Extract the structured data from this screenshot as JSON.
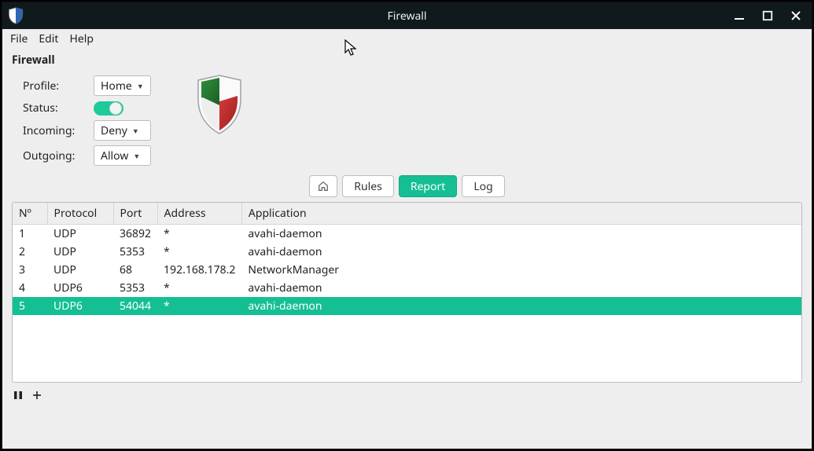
{
  "window": {
    "title": "Firewall"
  },
  "menubar": {
    "file": "File",
    "edit": "Edit",
    "help": "Help"
  },
  "panel": {
    "heading": "Firewall"
  },
  "form": {
    "profile_label": "Profile:",
    "status_label": "Status:",
    "incoming_label": "Incoming:",
    "outgoing_label": "Outgoing:",
    "profile_value": "Home",
    "incoming_value": "Deny",
    "outgoing_value": "Allow",
    "status_on": true
  },
  "colors": {
    "accent": "#15bf93",
    "titlebar_bg": "#10191b"
  },
  "tabs": {
    "home_tooltip": "Home",
    "rules": "Rules",
    "report": "Report",
    "log": "Log",
    "active": "report"
  },
  "table": {
    "columns": [
      "Nº",
      "Protocol",
      "Port",
      "Address",
      "Application"
    ],
    "rows": [
      {
        "n": "1",
        "protocol": "UDP",
        "port": "36892",
        "address": "*",
        "app": "avahi-daemon",
        "selected": false
      },
      {
        "n": "2",
        "protocol": "UDP",
        "port": "5353",
        "address": "*",
        "app": "avahi-daemon",
        "selected": false
      },
      {
        "n": "3",
        "protocol": "UDP",
        "port": "68",
        "address": "192.168.178.2",
        "app": "NetworkManager",
        "selected": false
      },
      {
        "n": "4",
        "protocol": "UDP6",
        "port": "5353",
        "address": "*",
        "app": "avahi-daemon",
        "selected": false
      },
      {
        "n": "5",
        "protocol": "UDP6",
        "port": "54044",
        "address": "*",
        "app": "avahi-daemon",
        "selected": true
      }
    ]
  },
  "footer": {
    "pause_icon": "pause-icon",
    "add_icon": "plus-icon"
  }
}
